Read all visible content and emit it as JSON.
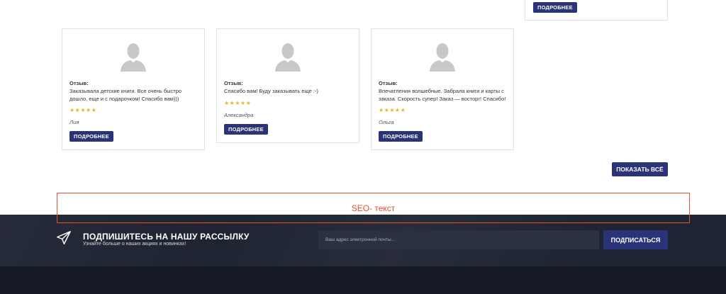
{
  "top_card": {
    "button_label": "ПОДРОБНЕЕ"
  },
  "reviews": [
    {
      "label": "Отзыв:",
      "text": "Заказывала детские книги. Все очень быстро дошло, еще и с подарочком! Спасибо вам)))",
      "stars": "★★★★★",
      "rating": 5,
      "author": "Лия",
      "button_label": "ПОДРОБНЕЕ"
    },
    {
      "label": "Отзыв:",
      "text": "Спасибо вам! Буду заказывать еще :-)",
      "stars": "★★★★★",
      "rating": 5,
      "author": "Александра",
      "button_label": "ПОДРОБНЕЕ"
    },
    {
      "label": "Отзыв:",
      "text": "Впечатления волшебные. Забрала книги и карты с заказа. Скорость супер! Заказ — восторг! Спасибо!",
      "stars": "★★★★★",
      "rating": 5,
      "author": "Ольга",
      "button_label": "ПОДРОБНЕЕ"
    }
  ],
  "show_all_label": "ПОКАЗАТЬ ВСЁ",
  "seo": {
    "text": "SEO- текст",
    "color": "#e0522e"
  },
  "newsletter": {
    "icon": "paper-plane-icon",
    "title": "ПОДПИШИТЕСЬ НА НАШУ РАССЫЛКУ",
    "subtitle": "Узнайте больше о наших акциях и новинках!",
    "placeholder": "Ваш адрес электронной почты...",
    "button_label": "ПОДПИСАТЬСЯ"
  },
  "colors": {
    "accent": "#2a3278",
    "star": "#e8b52a",
    "footer": "#1f2433",
    "footer_bottom": "#161a24"
  }
}
